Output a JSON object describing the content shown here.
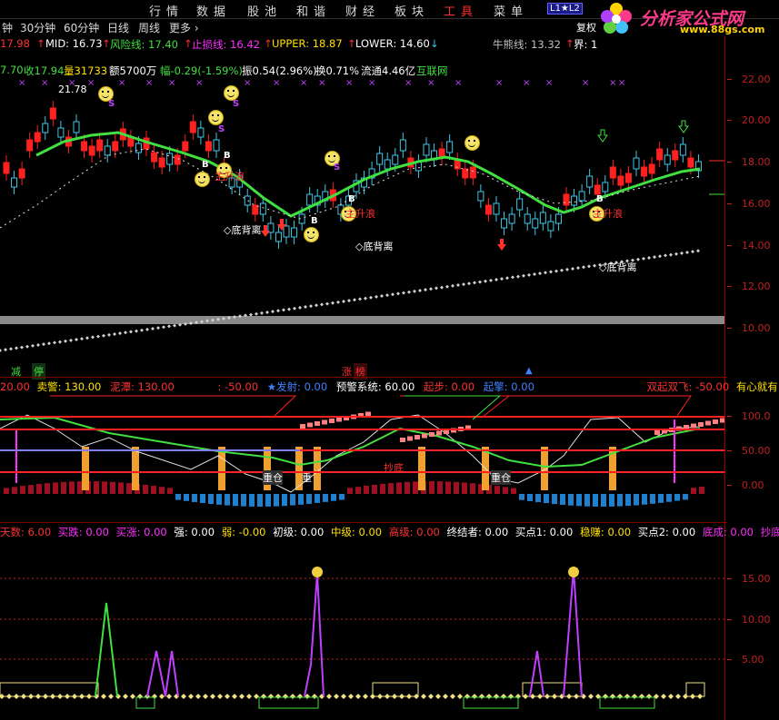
{
  "menubar": {
    "items": [
      "行",
      "情",
      "数",
      "据",
      "股",
      "池",
      "和",
      "谐",
      "财",
      "经",
      "板",
      "块",
      "工",
      "具",
      "菜",
      "单"
    ],
    "badge": "L1★L2",
    "right_label": "复权"
  },
  "logo": {
    "text": "分析家公式网",
    "url": "www.88gs.com"
  },
  "tabs": [
    "钟",
    "30分钟",
    "60分钟",
    "日线",
    "周线",
    "更多 ›"
  ],
  "indicator_bar": {
    "ma": "17.98",
    "mid": "MID: 16.73",
    "risk": "风险线: 17.40",
    "stop": "止损线: 16.42",
    "upper": "UPPER: 18.87",
    "lower": "LOWER: 14.60",
    "bear_line": "牛熊线: 13.32",
    "boundary": "界: 1"
  },
  "quote_bar": {
    "open": "7.70",
    "close": "收17.94",
    "volume": "量31733",
    "amount": "额5700万",
    "change": "幅-0.29(-1.59%)",
    "amplitude": "振0.54(2.96%)",
    "turnover": "换0.71%",
    "float": "流通4.46亿",
    "sector": "互联网"
  },
  "price_axis": [
    "22.00",
    "20.00",
    "18.00",
    "16.00",
    "14.00",
    "12.00",
    "10.00"
  ],
  "panel1_annotations": {
    "high_price": "21.78",
    "bottom_divergence": "底背离",
    "main_rise": "主升浪",
    "buy": "B",
    "sell": "S"
  },
  "panel1_footer": {
    "minus": "减",
    "stop": "停",
    "rise": "涨",
    "list": "榜"
  },
  "panel2": {
    "header": [
      {
        "text": "20.00",
        "color": "#ff3030"
      },
      {
        "text": "卖警: 130.00",
        "color": "#ffe000"
      },
      {
        "text": "泥潭: 130.00",
        "color": "#ff3030"
      },
      {
        "text": ": -50.00",
        "color": "#ff3030"
      },
      {
        "text": "★发射: 0.00",
        "color": "#4080ff"
      },
      {
        "text": "预警系统: 60.00",
        "color": "#ffffff"
      },
      {
        "text": "起步: 0.00",
        "color": "#ff3030"
      },
      {
        "text": "起擎: 0.00",
        "color": "#4080ff"
      },
      {
        "text": "双起双飞: -50.00",
        "color": "#ff3030"
      },
      {
        "text": "有心就有",
        "color": "#ffe000"
      }
    ],
    "axis": [
      "100.0",
      "50.00",
      "0.00"
    ],
    "labels": {
      "heavy_position": "重仓",
      "buy_bottom": "抄底",
      "heavy": "重"
    }
  },
  "panel3": {
    "header": [
      {
        "text": "天数: 6.00",
        "color": "#ff3030"
      },
      {
        "text": "买跌: 0.00",
        "color": "#ff30ff"
      },
      {
        "text": "买涨: 0.00",
        "color": "#ff30ff"
      },
      {
        "text": "强: 0.00",
        "color": "#ffffff"
      },
      {
        "text": "弱: -0.00",
        "color": "#ffe000"
      },
      {
        "text": "初级: 0.00",
        "color": "#ffffff"
      },
      {
        "text": "中级: 0.00",
        "color": "#ffe000"
      },
      {
        "text": "高级: 0.00",
        "color": "#ff3030"
      },
      {
        "text": "终结者: 0.00",
        "color": "#ffffff"
      },
      {
        "text": "买点1: 0.00",
        "color": "#ffffff"
      },
      {
        "text": "稳赚: 0.00",
        "color": "#ffe000"
      },
      {
        "text": "买点2: 0.00",
        "color": "#ffffff"
      },
      {
        "text": "底成: 0.00",
        "color": "#ff30ff"
      },
      {
        "text": "抄底",
        "color": "#ff30ff"
      }
    ],
    "axis": [
      "15.00",
      "10.00",
      "5.00"
    ]
  },
  "colors": {
    "up": "#ff2020",
    "down": "#40c8e8",
    "ma_green": "#40e040",
    "axis_red": "#c02020"
  }
}
